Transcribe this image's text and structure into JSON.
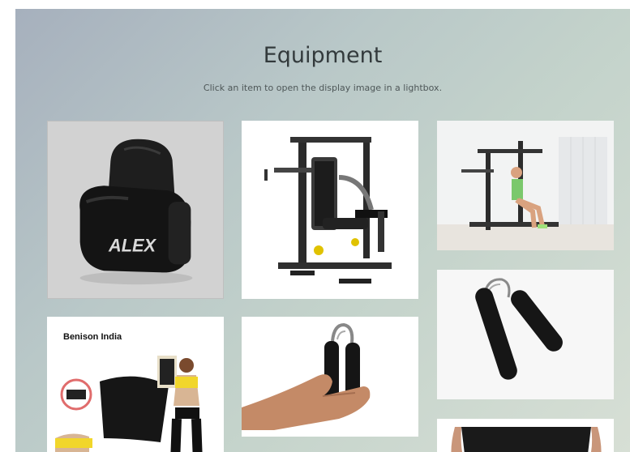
{
  "page": {
    "title": "Equipment",
    "subtitle": "Click an item to open the display image in a lightbox."
  },
  "gallery": {
    "items": [
      {
        "name": "boxing-gloves",
        "label": "ALEX"
      },
      {
        "name": "home-gym-machine"
      },
      {
        "name": "home-gym-in-use"
      },
      {
        "name": "hand-grip"
      },
      {
        "name": "sweat-belt",
        "label": "Benison India"
      },
      {
        "name": "hand-grip-in-hand"
      },
      {
        "name": "partial-item"
      }
    ]
  },
  "colors": {
    "background_start": "#a6b0bd",
    "background_end": "#d7dfd5",
    "title": "#333a3c"
  }
}
